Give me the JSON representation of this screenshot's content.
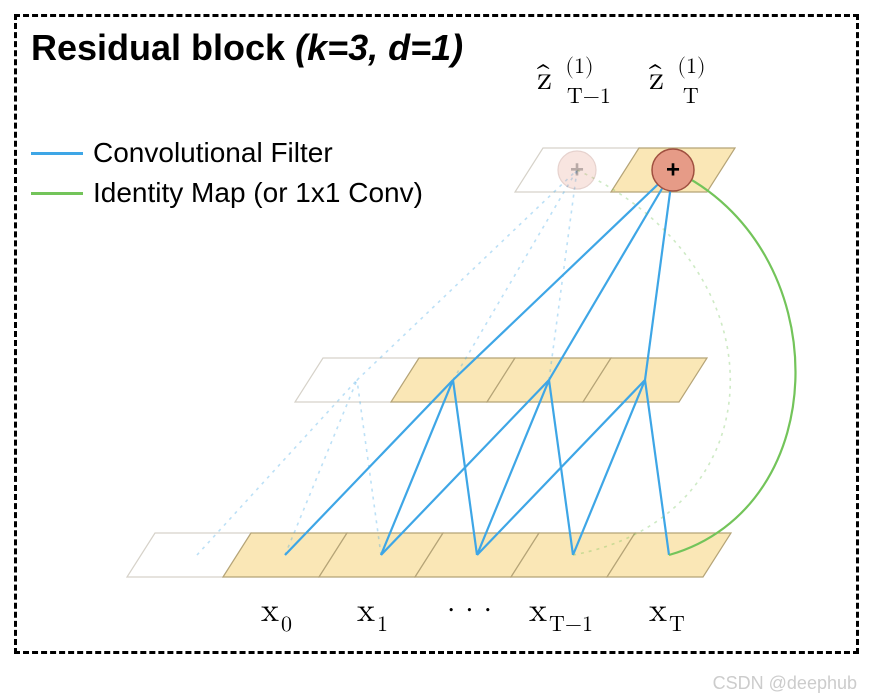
{
  "title": {
    "main": "Residual block ",
    "params": "(k=3, d=1)"
  },
  "legend": {
    "conv": {
      "label": "Convolutional Filter",
      "color": "#3ea6e6"
    },
    "identity": {
      "label": "Identity Map (or 1x1 Conv)",
      "color": "#73c45a"
    }
  },
  "top_labels": {
    "zhat_Tm1": {
      "base": "ẑ",
      "sub": "T−1",
      "sup": "(1)"
    },
    "zhat_T": {
      "base": "ẑ",
      "sub": "T",
      "sup": "(1)"
    }
  },
  "bottom_labels": {
    "x0": {
      "base": "x",
      "sub": "0"
    },
    "x1": {
      "base": "x",
      "sub": "1"
    },
    "dots": "· · ·",
    "xTm1": {
      "base": "x",
      "sub": "T−1"
    },
    "xT": {
      "base": "x",
      "sub": "T"
    }
  },
  "colors": {
    "cell_fill": "#fae7b6",
    "cell_stroke": "#b5a477",
    "conv": "#3ea6e6",
    "identity": "#73c45a",
    "plus_fill": "#e69b87"
  },
  "watermark": "CSDN @deephub"
}
